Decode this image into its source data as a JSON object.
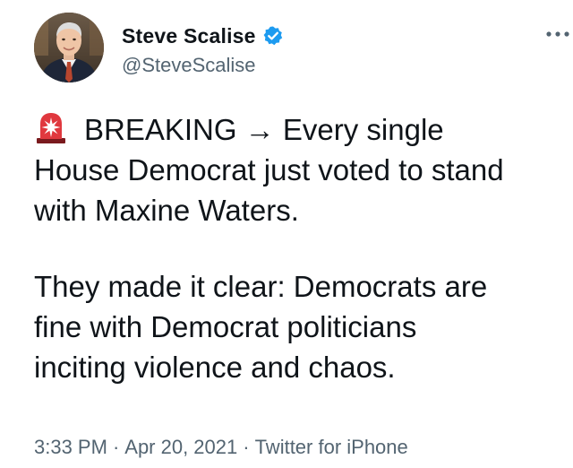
{
  "tweet": {
    "author": {
      "display_name": "Steve Scalise",
      "handle": "@SteveScalise",
      "verified": true,
      "verified_icon": "verified-badge-icon",
      "accent_color": "#1d9bf0"
    },
    "more_icon": "more-options-icon",
    "body": {
      "paragraph1": {
        "emoji": "police-siren-icon",
        "line1": "BREAKING → Every single",
        "line2": "House Democrat just voted to stand",
        "line3": "with Maxine Waters."
      },
      "paragraph2": {
        "line1": "They made it clear: Democrats are",
        "line2": "fine with Democrat politicians",
        "line3": "inciting violence and chaos."
      }
    },
    "meta": {
      "time": "3:33 PM",
      "date": "Apr 20, 2021",
      "source": "Twitter for iPhone",
      "separator": "·"
    },
    "colors": {
      "text": "#0f1419",
      "secondary": "#536471",
      "siren_red": "#e0383e"
    }
  }
}
